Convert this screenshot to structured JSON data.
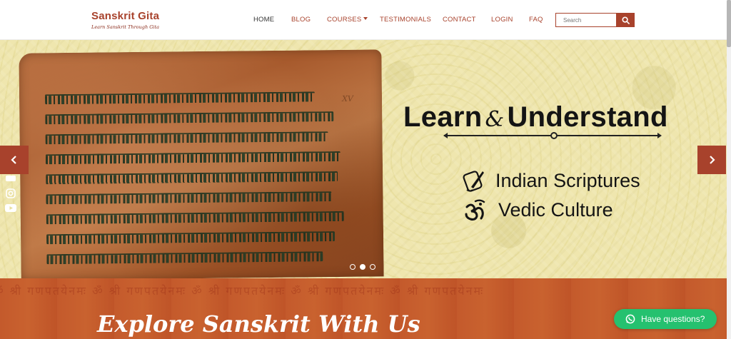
{
  "site": {
    "title": "Sanskrit Gita",
    "tagline": "Learn Sanskrit Through Gita"
  },
  "nav": {
    "items": [
      {
        "label": "HOME",
        "active": true
      },
      {
        "label": "BLOG"
      },
      {
        "label": "COURSES",
        "has_dropdown": true
      },
      {
        "label": "TESTIMONIALS"
      },
      {
        "label": "CONTACT"
      },
      {
        "label": "LOGIN"
      },
      {
        "label": "FAQ"
      }
    ]
  },
  "search": {
    "placeholder": "Search",
    "button_icon": "search-icon"
  },
  "hero": {
    "heading_part1": "Learn",
    "heading_amp": "&",
    "heading_part2": "Understand",
    "features": [
      {
        "icon": "scroll-quill-icon",
        "label": "Indian Scriptures"
      },
      {
        "icon": "om-icon",
        "label": "Vedic Culture"
      }
    ],
    "manuscript_note": "XV",
    "slide_count": 3,
    "active_slide": 2,
    "prev_icon": "chevron-left-icon",
    "next_icon": "chevron-right-icon"
  },
  "social": [
    "facebook-icon",
    "instagram-icon",
    "youtube-icon"
  ],
  "explore": {
    "title": "Explore Sanskrit With Us",
    "watermark": "ॐ श्री गणपतयेनमः ॐ श्री गणपतयेनमः ॐ श्री गणपतयेनमः ॐ श्री गणपतयेनमः ॐ श्री गणपतयेनमः"
  },
  "chat": {
    "label": "Have questions?",
    "icon": "whatsapp-icon"
  },
  "colors": {
    "brand": "#a8422c",
    "hero_bg": "#eee5ad",
    "chat_green": "#25c16f"
  }
}
